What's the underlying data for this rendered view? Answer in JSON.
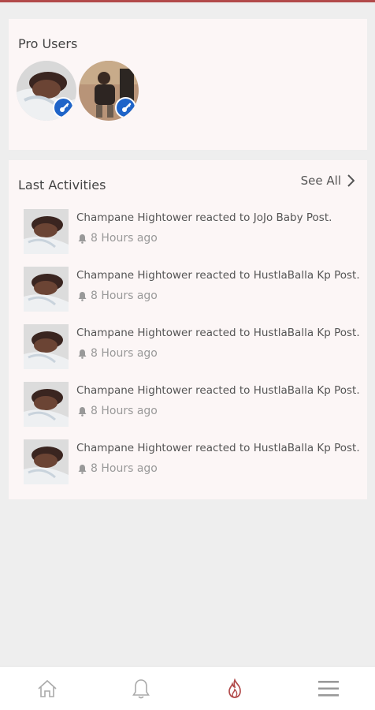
{
  "pro_users": {
    "title": "Pro Users",
    "users": [
      {
        "avatar": "user-photo"
      },
      {
        "avatar": "user-photo"
      }
    ]
  },
  "activities": {
    "title": "Last Activities",
    "see_all": "See All",
    "items": [
      {
        "text": "Champane Hightower reacted to JoJo Baby Post.",
        "time": "8 Hours ago"
      },
      {
        "text": "Champane Hightower reacted to HustlaBalla Kp Post.",
        "time": "8 Hours ago"
      },
      {
        "text": "Champane Hightower reacted to HustlaBalla Kp Post.",
        "time": "8 Hours ago"
      },
      {
        "text": "Champane Hightower reacted to HustlaBalla Kp Post.",
        "time": "8 Hours ago"
      },
      {
        "text": "Champane Hightower reacted to HustlaBalla Kp Post.",
        "time": "8 Hours ago"
      }
    ]
  },
  "nav": {
    "items": [
      "home-icon",
      "bell-icon",
      "fire-icon",
      "menu-icon"
    ],
    "active": "fire-icon"
  },
  "colors": {
    "accent": "#b24a4a",
    "badge": "#1f64c8",
    "card_bg": "#fcf6f6",
    "page_bg": "#eeeeee"
  }
}
